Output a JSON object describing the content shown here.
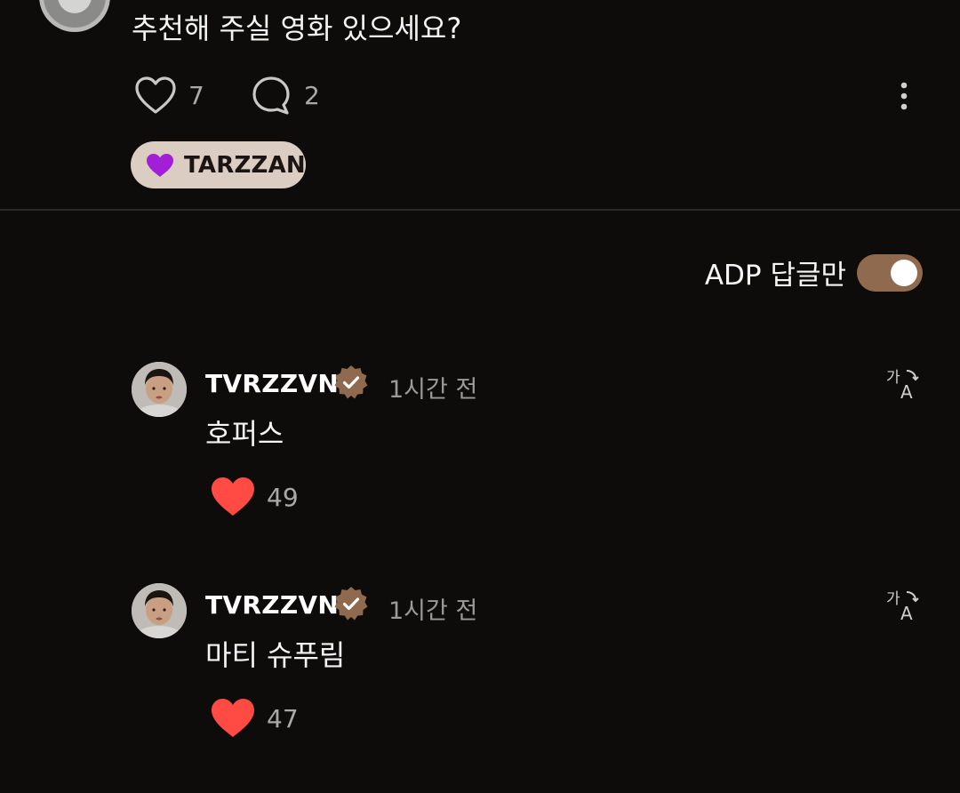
{
  "post": {
    "text": "추천해 주실 영화 있으세요?",
    "like_count": "7",
    "comment_count": "2",
    "tag": {
      "icon": "purple-heart-icon",
      "label": "TARZZAN",
      "color": "#a21fd8"
    }
  },
  "filter": {
    "label": "ADP 답글만",
    "enabled": true
  },
  "replies": [
    {
      "username": "TVRZZVN",
      "time": "1시간 전",
      "text": "호퍼스",
      "like_count": "49",
      "liked": true
    },
    {
      "username": "TVRZZVN",
      "time": "1시간 전",
      "text": "마티 슈푸림",
      "like_count": "47",
      "liked": true
    }
  ],
  "colors": {
    "background": "#0e0c0b",
    "accent": "#8f6a4f",
    "like": "#ff4b43"
  }
}
